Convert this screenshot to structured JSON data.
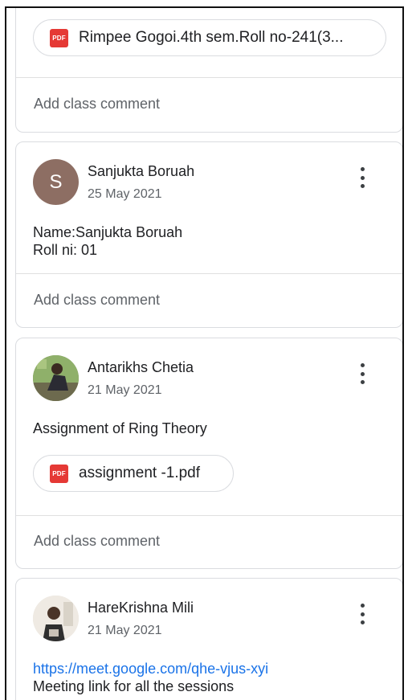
{
  "posts": [
    {
      "attachment": {
        "icon": "pdf-icon",
        "icon_text": "PDF",
        "name": "Rimpee Gogoi.4th sem.Roll no-241(3..."
      },
      "comment_placeholder": "Add class comment"
    },
    {
      "author": "Sanjukta Boruah",
      "avatar_letter": "S",
      "avatar_color": "#8d6e63",
      "date": "25 May 2021",
      "body_lines": [
        "Name:Sanjukta Boruah",
        "Roll ni: 01"
      ],
      "comment_placeholder": "Add class comment"
    },
    {
      "author": "Antarikhs Chetia",
      "date": "21 May 2021",
      "body_lines": [
        "Assignment of Ring Theory"
      ],
      "attachment": {
        "icon": "pdf-icon",
        "icon_text": "PDF",
        "name": "assignment -1.pdf"
      },
      "comment_placeholder": "Add class comment"
    },
    {
      "author": "HareKrishna Mili",
      "date": "21 May 2021",
      "link": "https://meet.google.com/qhe-vjus-xyi",
      "body_lines": [
        "Meeting link for all the sessions"
      ]
    }
  ],
  "colors": {
    "accent_link": "#1a73e8",
    "pdf_red": "#e53935",
    "border": "#dadce0"
  }
}
